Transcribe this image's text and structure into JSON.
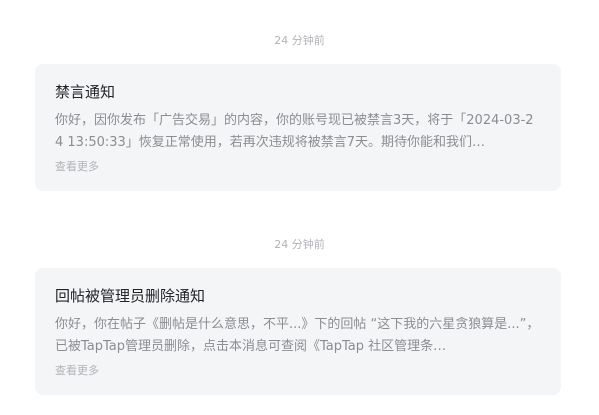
{
  "notifications": [
    {
      "time": "24 分钟前",
      "title": "禁言通知",
      "body": "你好，因你发布「广告交易」的内容，你的账号现已被禁言3天，将于「2024-03-24 13:50:33」恢复正常使用，若再次违规将被禁言7天。期待你能和我们…",
      "more": "查看更多"
    },
    {
      "time": "24 分钟前",
      "title": "回帖被管理员删除通知",
      "body": "你好，你在帖子《删帖是什么意思，不平...》下的回帖 “这下我的六星贪狼算是...”，已被TapTap管理员删除，点击本消息可查阅《TapTap 社区管理条…",
      "more": "查看更多"
    }
  ]
}
